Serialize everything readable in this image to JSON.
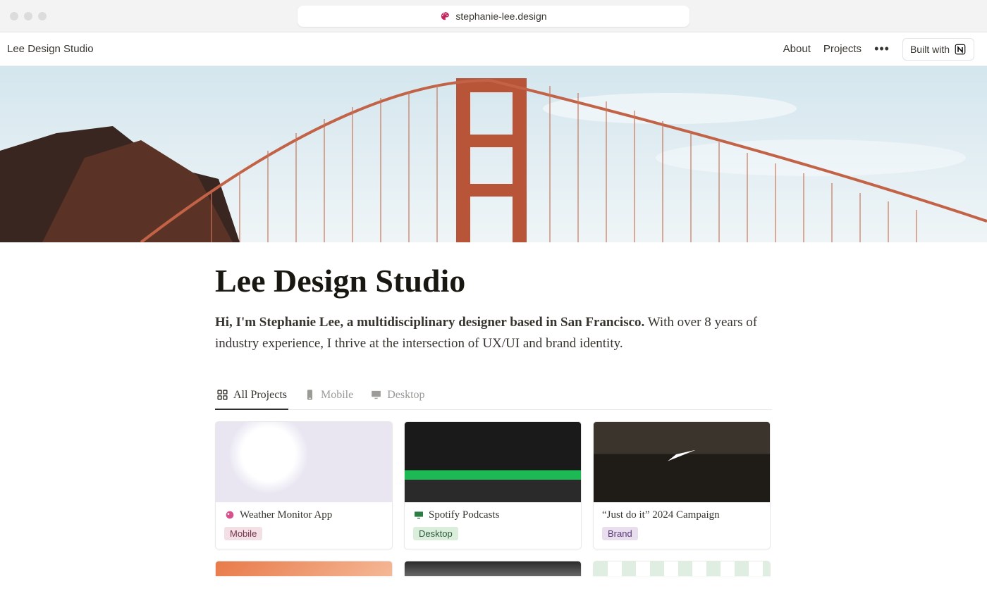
{
  "browser": {
    "url": "stephanie-lee.design"
  },
  "nav": {
    "site_name": "Lee Design Studio",
    "about": "About",
    "projects": "Projects",
    "built_with": "Built with"
  },
  "page": {
    "title": "Lee Design Studio",
    "intro_bold": "Hi, I'm Stephanie Lee, a multidisciplinary designer based in San Francisco.",
    "intro_rest": " With over 8 years of industry experience, I thrive at the intersection of UX/UI and brand identity."
  },
  "tabs": [
    {
      "label": "All Projects",
      "active": true
    },
    {
      "label": "Mobile",
      "active": false
    },
    {
      "label": "Desktop",
      "active": false
    }
  ],
  "cards": [
    {
      "title": "Weather Monitor App",
      "tag": "Mobile",
      "tag_class": "tag-mobile",
      "has_emoji": true
    },
    {
      "title": "Spotify Podcasts",
      "tag": "Desktop",
      "tag_class": "tag-desktop",
      "has_emoji": true
    },
    {
      "title": "“Just do it” 2024 Campaign",
      "tag": "Brand",
      "tag_class": "tag-brand",
      "has_emoji": false
    }
  ]
}
